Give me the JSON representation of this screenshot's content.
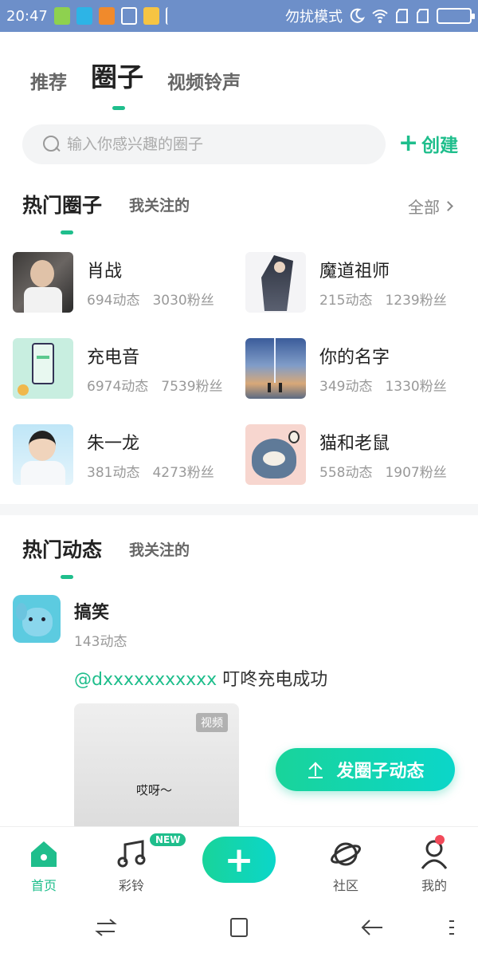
{
  "status_bar": {
    "time": "20:47",
    "dnd_text": "勿扰模式"
  },
  "top_tabs": [
    {
      "label": "推荐",
      "active": false
    },
    {
      "label": "圈子",
      "active": true
    },
    {
      "label": "视频铃声",
      "active": false
    }
  ],
  "search": {
    "placeholder": "输入你感兴趣的圈子",
    "create_label": "创建"
  },
  "hot_circles": {
    "title": "热门圈子",
    "subtab": "我关注的",
    "all_label": "全部",
    "items": [
      {
        "name": "肖战",
        "posts": "694动态",
        "fans": "3030粉丝"
      },
      {
        "name": "魔道祖师",
        "posts": "215动态",
        "fans": "1239粉丝"
      },
      {
        "name": "充电音",
        "posts": "6974动态",
        "fans": "7539粉丝"
      },
      {
        "name": "你的名字",
        "posts": "349动态",
        "fans": "1330粉丝"
      },
      {
        "name": "朱一龙",
        "posts": "381动态",
        "fans": "4273粉丝"
      },
      {
        "name": "猫和老鼠",
        "posts": "558动态",
        "fans": "1907粉丝"
      }
    ]
  },
  "hot_posts": {
    "title": "热门动态",
    "subtab": "我关注的",
    "post": {
      "circle_name": "搞笑",
      "circle_posts": "143动态",
      "mention": "@dxxxxxxxxxxx",
      "text": "叮咚充电成功",
      "video_tag": "视频",
      "video_caption": "哎呀～"
    }
  },
  "fab": {
    "label": "发圈子动态"
  },
  "bottom_nav": {
    "items": [
      {
        "label": "首页",
        "icon": "home-icon"
      },
      {
        "label": "彩铃",
        "icon": "music-note-icon"
      },
      {
        "label": "社区",
        "icon": "planet-icon"
      },
      {
        "label": "我的",
        "icon": "profile-icon"
      }
    ],
    "new_badge": "NEW"
  },
  "colors": {
    "accent": "#1fbe8c",
    "status_bar": "#6d8fc9"
  }
}
